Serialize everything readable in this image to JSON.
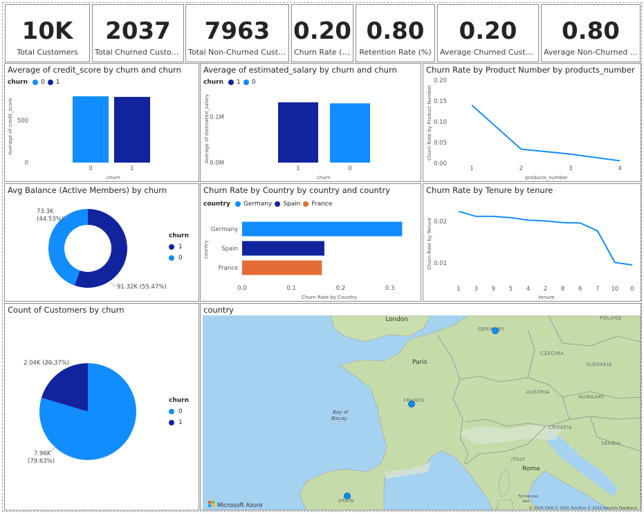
{
  "colors": {
    "light_blue": "#118DFF",
    "dark_blue": "#12239E",
    "orange": "#E66C37",
    "line": "#118DFF"
  },
  "kpis": [
    {
      "value": "10K",
      "label": "Total Customers"
    },
    {
      "value": "2037",
      "label": "Total Churned Customers"
    },
    {
      "value": "7963",
      "label": "Total Non-Churned Customers"
    },
    {
      "value": "0.20",
      "label": "Churn Rate (%)"
    },
    {
      "value": "0.80",
      "label": "Retention Rate (%)"
    },
    {
      "value": "0.20",
      "label": "Average Churned Customers"
    },
    {
      "value": "0.80",
      "label": "Average Non-Churned Customers"
    }
  ],
  "credit": {
    "title": "Average of credit_score by churn and churn",
    "legend_title": "churn",
    "legend": [
      "0",
      "1"
    ],
    "ylabel": "Average of credit_score",
    "xlabel": "churn",
    "yticks": [
      "500",
      "0"
    ]
  },
  "salary": {
    "title": "Average of estimated_salary by churn and churn",
    "legend_title": "churn",
    "legend": [
      "1",
      "0"
    ],
    "ylabel": "Average of estimated_salary",
    "xlabel": "churn",
    "yticks": [
      "0.1M",
      "0.0M"
    ]
  },
  "product": {
    "title": "Churn Rate by Product Number by products_number",
    "ylabel": "Churn Rate by Product Number",
    "xlabel": "products_number",
    "yticks": [
      "0.20",
      "0.15",
      "0.10",
      "0.05",
      "0.00"
    ]
  },
  "balance": {
    "title": "Avg Balance (Active Members) by churn",
    "legend_title": "churn",
    "legend": [
      "1",
      "0"
    ],
    "label_small_1": "73.3K",
    "label_small_2": "(44.53%)",
    "label_big": "91.32K (55.47%)"
  },
  "country_chart": {
    "title": "Churn Rate by Country by country and country",
    "legend_title": "country",
    "legend": [
      "Germany",
      "Spain",
      "France"
    ],
    "ylabel": "country",
    "xlabel": "Churn Rate by Country",
    "xticks": [
      "0.0",
      "0.1",
      "0.2",
      "0.3"
    ]
  },
  "tenure": {
    "title": "Churn Rate by Tenure by tenure",
    "ylabel": "Churn Rate by Tenure",
    "xlabel": "tenure",
    "yticks": [
      "0.02",
      "0.01"
    ]
  },
  "count": {
    "title": "Count of Customers by churn",
    "legend_title": "churn",
    "legend": [
      "0",
      "1"
    ],
    "label_small_1": "2.04K (20.37%)",
    "label_big_1": "7.96K",
    "label_big_2": "(79.63%)"
  },
  "map": {
    "title": "country",
    "labels": {
      "london": "London",
      "paris": "Paris",
      "france": "FRANCE",
      "germany": "GERMANY",
      "spain": "SPAIN",
      "italy": "ITALY",
      "rome": "Rome",
      "austria": "AUSTRIA",
      "hungary": "HUNGARY",
      "czechia": "CZECHIA",
      "slovakia": "SLOVAKIA",
      "croatia": "CROATIA",
      "serbia": "SERBIA",
      "poland": "POLAND",
      "bay": "Bay of",
      "biscay": "Biscay",
      "tyrr1": "Tyrrhenian",
      "tyrr2": "Sea"
    },
    "brand": "Microsoft Azure",
    "attribution": "© 2025 OSM  © 2025 TomTom  © 2025 NavInfo  Feedback"
  },
  "chart_data": [
    {
      "type": "bar",
      "title": "Average of credit_score by churn and churn",
      "xlabel": "churn",
      "ylabel": "Average of credit_score",
      "categories": [
        "0",
        "1"
      ],
      "values": [
        651,
        645
      ],
      "ylim": [
        0,
        700
      ]
    },
    {
      "type": "bar",
      "title": "Average of estimated_salary by churn and churn",
      "xlabel": "churn",
      "ylabel": "Average of estimated_salary",
      "categories": [
        "1",
        "0"
      ],
      "values": [
        101466,
        99726
      ],
      "ylim": [
        0,
        120000
      ]
    },
    {
      "type": "line",
      "title": "Churn Rate by Product Number by products_number",
      "xlabel": "products_number",
      "ylabel": "Churn Rate by Product Number",
      "x": [
        1,
        2,
        3,
        4
      ],
      "values": [
        0.14,
        0.034,
        0.022,
        0.006
      ],
      "ylim": [
        0,
        0.2
      ]
    },
    {
      "type": "pie",
      "title": "Avg Balance (Active Members) by churn",
      "categories": [
        "1",
        "0"
      ],
      "values": [
        91320,
        73300
      ],
      "donut": true
    },
    {
      "type": "bar",
      "orientation": "horizontal",
      "title": "Churn Rate by Country by country and country",
      "xlabel": "Churn Rate by Country",
      "ylabel": "country",
      "categories": [
        "Germany",
        "Spain",
        "France"
      ],
      "values": [
        0.325,
        0.167,
        0.162
      ],
      "xlim": [
        0,
        0.33
      ]
    },
    {
      "type": "line",
      "title": "Churn Rate by Tenure by tenure",
      "xlabel": "tenure",
      "ylabel": "Churn Rate by Tenure",
      "x": [
        "1",
        "3",
        "9",
        "5",
        "4",
        "2",
        "8",
        "6",
        "7",
        "10",
        "0"
      ],
      "values": [
        0.0224,
        0.0212,
        0.0212,
        0.0209,
        0.0203,
        0.0201,
        0.0197,
        0.0196,
        0.0177,
        0.0101,
        0.0095
      ]
    },
    {
      "type": "pie",
      "title": "Count of Customers by churn",
      "categories": [
        "0",
        "1"
      ],
      "values": [
        7963,
        2037
      ]
    }
  ]
}
